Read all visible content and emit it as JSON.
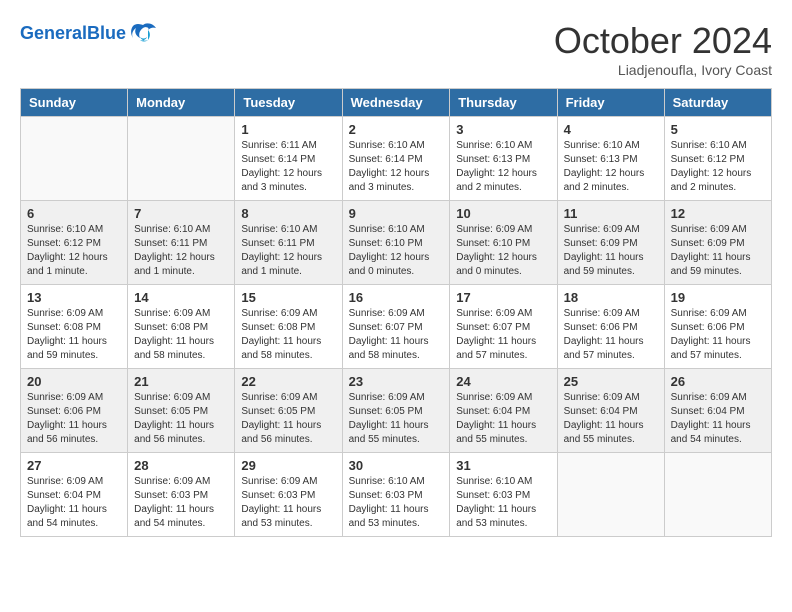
{
  "logo": {
    "text_general": "General",
    "text_blue": "Blue"
  },
  "header": {
    "month": "October 2024",
    "location": "Liadjenoufla, Ivory Coast"
  },
  "weekdays": [
    "Sunday",
    "Monday",
    "Tuesday",
    "Wednesday",
    "Thursday",
    "Friday",
    "Saturday"
  ],
  "weeks": [
    [
      {
        "day": "",
        "detail": ""
      },
      {
        "day": "",
        "detail": ""
      },
      {
        "day": "1",
        "detail": "Sunrise: 6:11 AM\nSunset: 6:14 PM\nDaylight: 12 hours\nand 3 minutes."
      },
      {
        "day": "2",
        "detail": "Sunrise: 6:10 AM\nSunset: 6:14 PM\nDaylight: 12 hours\nand 3 minutes."
      },
      {
        "day": "3",
        "detail": "Sunrise: 6:10 AM\nSunset: 6:13 PM\nDaylight: 12 hours\nand 2 minutes."
      },
      {
        "day": "4",
        "detail": "Sunrise: 6:10 AM\nSunset: 6:13 PM\nDaylight: 12 hours\nand 2 minutes."
      },
      {
        "day": "5",
        "detail": "Sunrise: 6:10 AM\nSunset: 6:12 PM\nDaylight: 12 hours\nand 2 minutes."
      }
    ],
    [
      {
        "day": "6",
        "detail": "Sunrise: 6:10 AM\nSunset: 6:12 PM\nDaylight: 12 hours\nand 1 minute."
      },
      {
        "day": "7",
        "detail": "Sunrise: 6:10 AM\nSunset: 6:11 PM\nDaylight: 12 hours\nand 1 minute."
      },
      {
        "day": "8",
        "detail": "Sunrise: 6:10 AM\nSunset: 6:11 PM\nDaylight: 12 hours\nand 1 minute."
      },
      {
        "day": "9",
        "detail": "Sunrise: 6:10 AM\nSunset: 6:10 PM\nDaylight: 12 hours\nand 0 minutes."
      },
      {
        "day": "10",
        "detail": "Sunrise: 6:09 AM\nSunset: 6:10 PM\nDaylight: 12 hours\nand 0 minutes."
      },
      {
        "day": "11",
        "detail": "Sunrise: 6:09 AM\nSunset: 6:09 PM\nDaylight: 11 hours\nand 59 minutes."
      },
      {
        "day": "12",
        "detail": "Sunrise: 6:09 AM\nSunset: 6:09 PM\nDaylight: 11 hours\nand 59 minutes."
      }
    ],
    [
      {
        "day": "13",
        "detail": "Sunrise: 6:09 AM\nSunset: 6:08 PM\nDaylight: 11 hours\nand 59 minutes."
      },
      {
        "day": "14",
        "detail": "Sunrise: 6:09 AM\nSunset: 6:08 PM\nDaylight: 11 hours\nand 58 minutes."
      },
      {
        "day": "15",
        "detail": "Sunrise: 6:09 AM\nSunset: 6:08 PM\nDaylight: 11 hours\nand 58 minutes."
      },
      {
        "day": "16",
        "detail": "Sunrise: 6:09 AM\nSunset: 6:07 PM\nDaylight: 11 hours\nand 58 minutes."
      },
      {
        "day": "17",
        "detail": "Sunrise: 6:09 AM\nSunset: 6:07 PM\nDaylight: 11 hours\nand 57 minutes."
      },
      {
        "day": "18",
        "detail": "Sunrise: 6:09 AM\nSunset: 6:06 PM\nDaylight: 11 hours\nand 57 minutes."
      },
      {
        "day": "19",
        "detail": "Sunrise: 6:09 AM\nSunset: 6:06 PM\nDaylight: 11 hours\nand 57 minutes."
      }
    ],
    [
      {
        "day": "20",
        "detail": "Sunrise: 6:09 AM\nSunset: 6:06 PM\nDaylight: 11 hours\nand 56 minutes."
      },
      {
        "day": "21",
        "detail": "Sunrise: 6:09 AM\nSunset: 6:05 PM\nDaylight: 11 hours\nand 56 minutes."
      },
      {
        "day": "22",
        "detail": "Sunrise: 6:09 AM\nSunset: 6:05 PM\nDaylight: 11 hours\nand 56 minutes."
      },
      {
        "day": "23",
        "detail": "Sunrise: 6:09 AM\nSunset: 6:05 PM\nDaylight: 11 hours\nand 55 minutes."
      },
      {
        "day": "24",
        "detail": "Sunrise: 6:09 AM\nSunset: 6:04 PM\nDaylight: 11 hours\nand 55 minutes."
      },
      {
        "day": "25",
        "detail": "Sunrise: 6:09 AM\nSunset: 6:04 PM\nDaylight: 11 hours\nand 55 minutes."
      },
      {
        "day": "26",
        "detail": "Sunrise: 6:09 AM\nSunset: 6:04 PM\nDaylight: 11 hours\nand 54 minutes."
      }
    ],
    [
      {
        "day": "27",
        "detail": "Sunrise: 6:09 AM\nSunset: 6:04 PM\nDaylight: 11 hours\nand 54 minutes."
      },
      {
        "day": "28",
        "detail": "Sunrise: 6:09 AM\nSunset: 6:03 PM\nDaylight: 11 hours\nand 54 minutes."
      },
      {
        "day": "29",
        "detail": "Sunrise: 6:09 AM\nSunset: 6:03 PM\nDaylight: 11 hours\nand 53 minutes."
      },
      {
        "day": "30",
        "detail": "Sunrise: 6:10 AM\nSunset: 6:03 PM\nDaylight: 11 hours\nand 53 minutes."
      },
      {
        "day": "31",
        "detail": "Sunrise: 6:10 AM\nSunset: 6:03 PM\nDaylight: 11 hours\nand 53 minutes."
      },
      {
        "day": "",
        "detail": ""
      },
      {
        "day": "",
        "detail": ""
      }
    ]
  ]
}
